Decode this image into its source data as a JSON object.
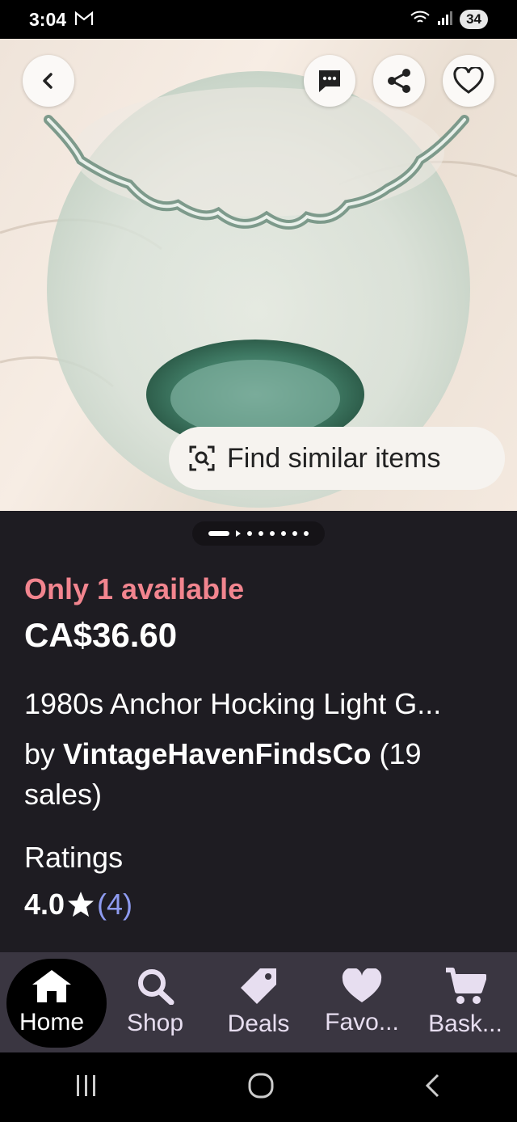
{
  "status": {
    "time": "3:04",
    "battery": "34",
    "mail_icon": "gmail-icon"
  },
  "header_buttons": [
    "back-icon",
    "message-icon",
    "share-icon",
    "heart-icon"
  ],
  "find_similar": {
    "label": "Find similar items",
    "icon": "image-search-icon"
  },
  "carousel": {
    "total_dots": 8,
    "active_index": 0
  },
  "listing": {
    "availability": "Only 1 available",
    "price": "CA$36.60",
    "title": "1980s Anchor Hocking Light G...",
    "by": "by ",
    "shop_name": "VintageHavenFindsCo",
    "sales": " (19 sales)"
  },
  "ratings": {
    "label": "Ratings",
    "value": "4.0",
    "count": "(4)"
  },
  "tabs": [
    {
      "label": "Home",
      "icon": "home-icon",
      "active": true
    },
    {
      "label": "Shop",
      "icon": "search-icon"
    },
    {
      "label": "Deals",
      "icon": "tag-icon"
    },
    {
      "label": "Favo...",
      "icon": "heart-icon"
    },
    {
      "label": "Bask...",
      "icon": "cart-icon"
    }
  ],
  "colors": {
    "availability": "#f2858f",
    "rating_count": "#8e9bf0",
    "background": "#1e1c22",
    "tabbar": "#3a3641"
  }
}
